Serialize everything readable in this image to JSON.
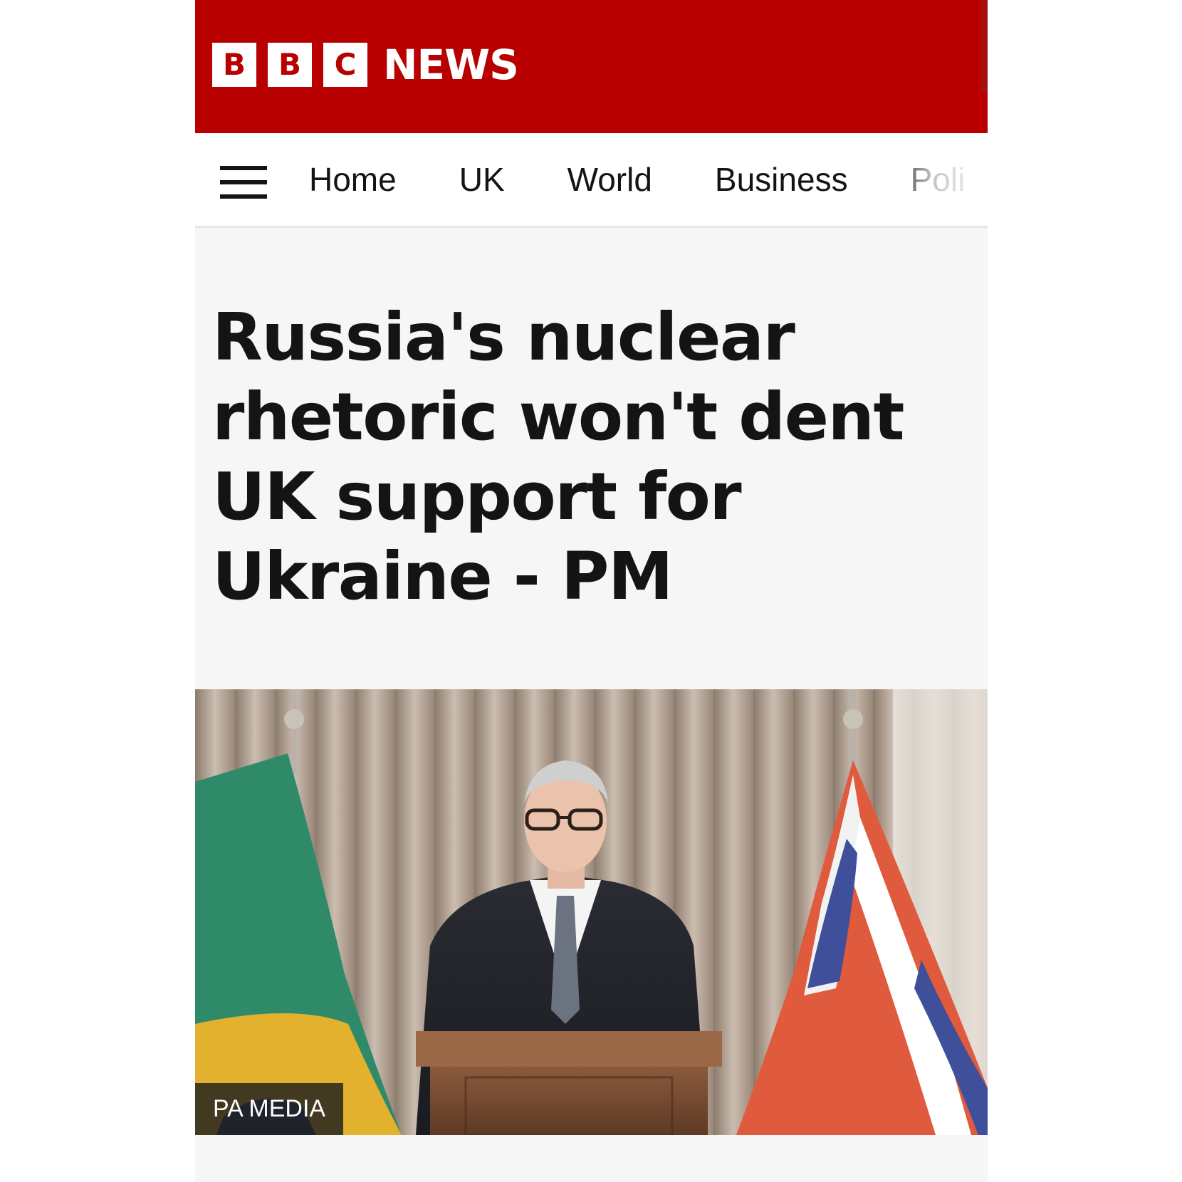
{
  "header": {
    "logo_letters": [
      "B",
      "B",
      "C"
    ],
    "logo_word": "NEWS",
    "brand_color": "#b80000"
  },
  "nav": {
    "menu_icon": "hamburger-icon",
    "items": [
      "Home",
      "UK",
      "World",
      "Business",
      "Poli"
    ]
  },
  "article": {
    "headline": "Russia's nuclear rhetoric won't dent UK support for Ukraine - PM",
    "image": {
      "credit": "PA MEDIA"
    }
  }
}
